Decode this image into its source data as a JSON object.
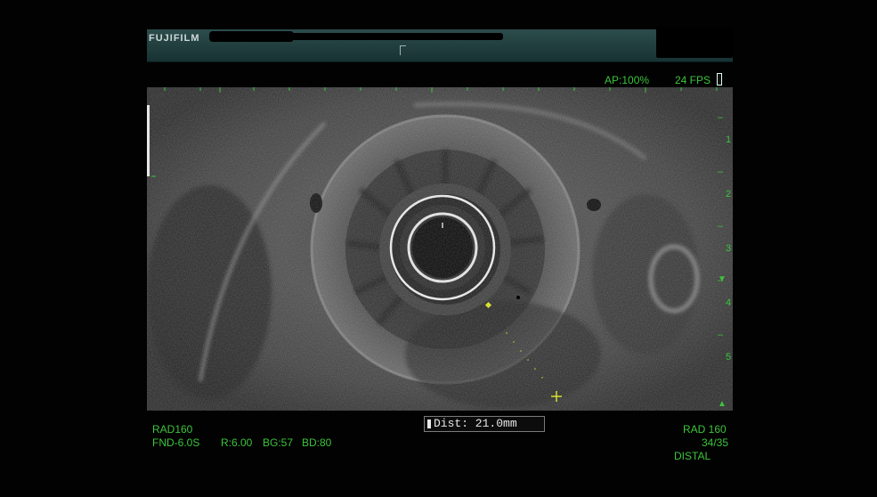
{
  "header": {
    "brand": "FUJIFILM"
  },
  "status": {
    "ap": "AP:100%",
    "fps": "24 FPS"
  },
  "depth_scale": {
    "labels": [
      "1",
      "2",
      "3",
      "4",
      "5"
    ]
  },
  "left_panel": {
    "probe": "RAD160",
    "settings": "FND-6.0S",
    "r": "R:6.00",
    "bg": "BG:57",
    "bd": "BD:80"
  },
  "measurement": {
    "distance": "Dist: 21.0mm"
  },
  "right_panel": {
    "probe": "RAD 160",
    "frame": "34/35",
    "position": "DISTAL"
  },
  "colors": {
    "overlay_text": "#3cc43c",
    "header_bg": "#2c4c4c",
    "marker": "#d8e030"
  }
}
